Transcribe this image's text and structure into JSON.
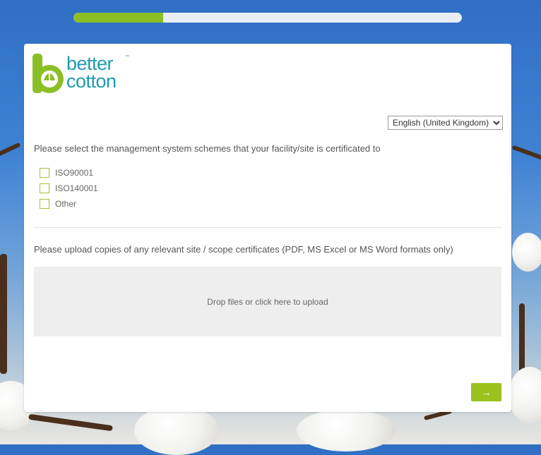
{
  "progress": {
    "percent": 23
  },
  "brand": {
    "line1": "better",
    "line2": "cotton",
    "tm": "™"
  },
  "language": {
    "selected": "English (United Kingdom)"
  },
  "question": {
    "text": "Please select the management system schemes that your facility/site is certificated to"
  },
  "options": [
    {
      "label": "ISO90001",
      "checked": false
    },
    {
      "label": "ISO140001",
      "checked": false
    },
    {
      "label": "Other",
      "checked": false
    }
  ],
  "upload": {
    "question": "Please upload copies of any relevant site / scope certificates (PDF, MS Excel or MS Word formats only)",
    "dropzone_text": "Drop files or click here to upload"
  },
  "next": {
    "icon": "arrow-right-icon",
    "label": "→"
  },
  "colors": {
    "accent": "#99c21f",
    "brand_teal": "#1f9bb0",
    "progress_track": "#e9eef3"
  }
}
